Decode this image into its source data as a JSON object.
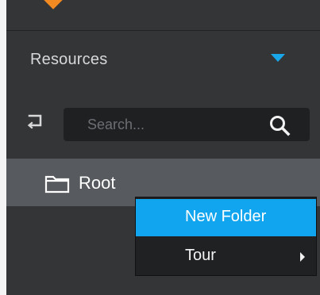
{
  "header": {
    "title": "Resources"
  },
  "search": {
    "placeholder": "Search..."
  },
  "tree": {
    "root_label": "Root"
  },
  "context_menu": {
    "items": [
      {
        "label": "New Folder",
        "icon": "none",
        "submenu": false
      },
      {
        "label": "Tour",
        "icon": "chevron-right-icon",
        "submenu": true
      }
    ]
  },
  "icons": {
    "return": "return-icon",
    "search": "search-icon",
    "folder": "folder-icon",
    "dropdown": "caret-down-icon"
  },
  "colors": {
    "panel_bg": "#333537",
    "selected_row_bg": "#575a5e",
    "accent": "#1aa7ea",
    "menu_hover": "#11a5ef"
  }
}
